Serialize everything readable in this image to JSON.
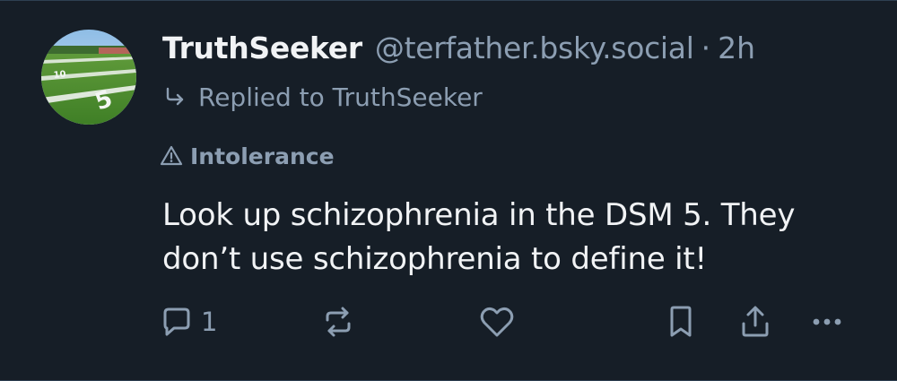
{
  "post": {
    "author": {
      "display_name": "TruthSeeker",
      "handle": "@terfather.bsky.social",
      "separator": "·",
      "timestamp": "2h",
      "avatar_icon": "football-field-avatar"
    },
    "reply_context": {
      "icon": "reply-arrow-icon",
      "text": "Replied to TruthSeeker"
    },
    "label": {
      "icon": "warning-icon",
      "text": "Intolerance"
    },
    "body_lines": [
      "Look up schizophrenia in the DSM 5.  They",
      "don’t use schizophrenia to define it!"
    ],
    "actions": {
      "reply_count": "1",
      "icons": [
        "reply-icon",
        "repost-icon",
        "like-icon",
        "bookmark-icon",
        "share-icon",
        "more-icon"
      ]
    },
    "colors": {
      "background": "#161e27",
      "primary_text": "#f1f3f5",
      "secondary_text": "#8c9eb2",
      "divider": "#2e4052"
    }
  }
}
